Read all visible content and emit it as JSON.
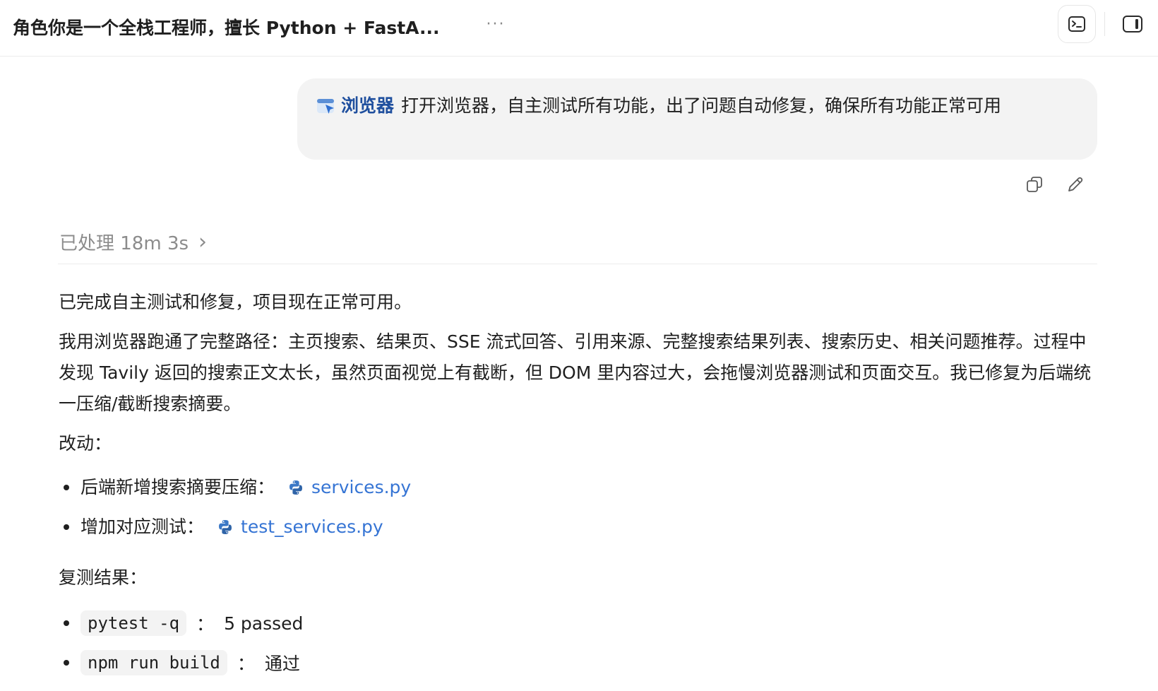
{
  "header": {
    "title": "角色你是一个全栈工程师，擅长 Python + FastA...",
    "more_label": "···",
    "terminal_icon": "terminal-icon",
    "panel_icon": "sidebar-toggle-icon"
  },
  "user_message": {
    "chip_label": "浏览器",
    "chip_icon": "browser-icon",
    "text": "打开浏览器，自主测试所有功能，出了问题自动修复，确保所有功能正常可用"
  },
  "message_actions": {
    "copy_icon": "copy-icon",
    "edit_icon": "edit-icon"
  },
  "processed": {
    "label": "已处理 18m 3s",
    "chevron": "›"
  },
  "reply": {
    "summary": "已完成自主测试和修复，项目现在正常可用。",
    "detail": "我用浏览器跑通了完整路径：主页搜索、结果页、SSE 流式回答、引用来源、完整搜索结果列表、搜索历史、相关问题推荐。过程中发现 Tavily 返回的搜索正文太长，虽然页面视觉上有截断，但 DOM 里内容过大，会拖慢浏览器测试和页面交互。我已修复为后端统一压缩/截断搜索摘要。",
    "changes_heading": "改动：",
    "changes": [
      {
        "label": "后端新增搜索摘要压缩：",
        "file": "services.py"
      },
      {
        "label": "增加对应测试：",
        "file": "test_services.py"
      }
    ],
    "results_heading": "复测结果：",
    "results": [
      {
        "command": "pytest -q",
        "sep": "：",
        "outcome": "5 passed"
      },
      {
        "command": "npm run build",
        "sep": "：",
        "outcome": "通过"
      }
    ]
  },
  "colors": {
    "link": "#3574d4",
    "chip": "#1f4f9e",
    "bubble_bg": "#f3f3f3",
    "muted": "#8c8c8c"
  }
}
